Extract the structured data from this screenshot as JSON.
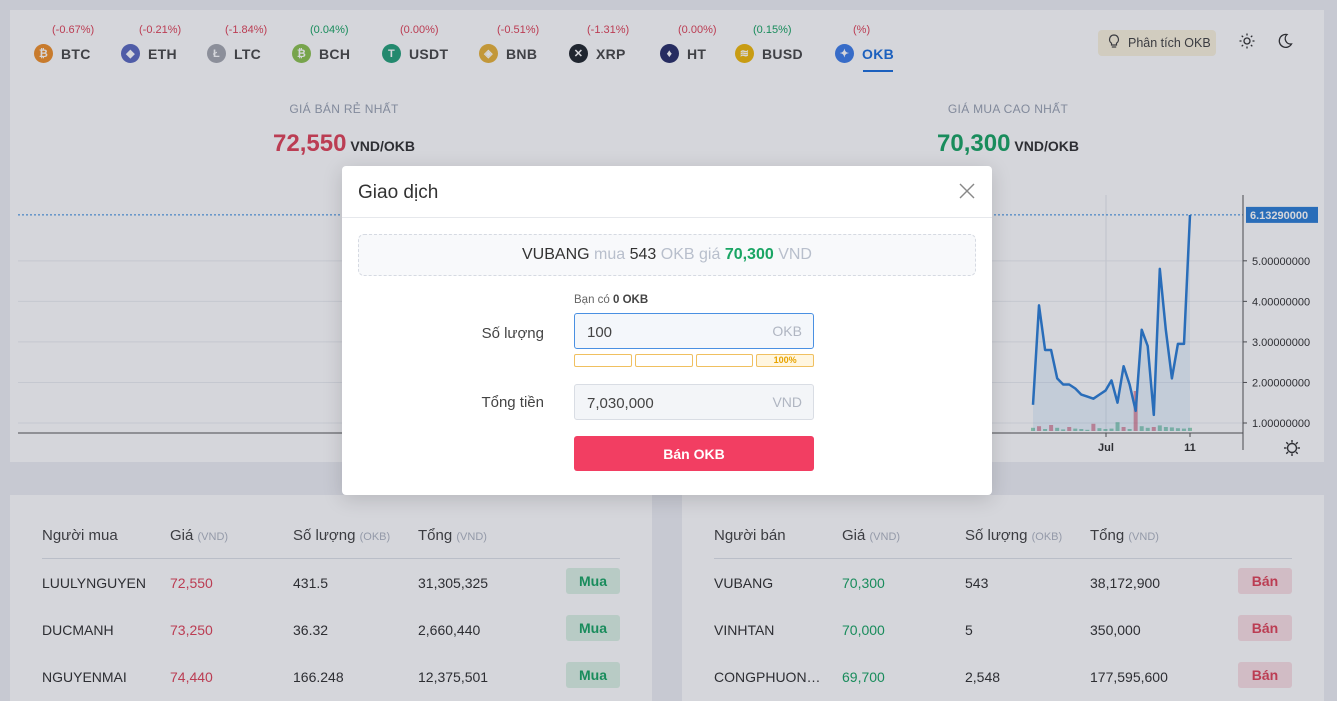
{
  "ticker": [
    {
      "symbol": "BTC",
      "change": "(-0.67%)",
      "trend": "neg",
      "color": "#f0902b",
      "glyph": "₿",
      "icon": "bitcoin-icon"
    },
    {
      "symbol": "ETH",
      "change": "(-0.21%)",
      "trend": "neg",
      "color": "#5c6bc0",
      "glyph": "◆",
      "icon": "ethereum-icon"
    },
    {
      "symbol": "LTC",
      "change": "(-1.84%)",
      "trend": "neg",
      "color": "#a6a9b0",
      "glyph": "Ł",
      "icon": "litecoin-icon"
    },
    {
      "symbol": "BCH",
      "change": "(0.04%)",
      "trend": "pos",
      "color": "#8dc351",
      "glyph": "₿",
      "icon": "bitcoin-cash-icon"
    },
    {
      "symbol": "USDT",
      "change": "(0.00%)",
      "trend": "neg",
      "color": "#26a17b",
      "glyph": "T",
      "icon": "tether-icon"
    },
    {
      "symbol": "BNB",
      "change": "(-0.51%)",
      "trend": "neg",
      "color": "#e8b33a",
      "glyph": "◈",
      "icon": "binance-coin-icon"
    },
    {
      "symbol": "XRP",
      "change": "(-1.31%)",
      "trend": "neg",
      "color": "#23292f",
      "glyph": "✕",
      "icon": "ripple-icon"
    },
    {
      "symbol": "HT",
      "change": "(0.00%)",
      "trend": "neg",
      "color": "#2a3069",
      "glyph": "♦",
      "icon": "huobi-token-icon"
    },
    {
      "symbol": "BUSD",
      "change": "(0.15%)",
      "trend": "pos",
      "color": "#f0b90b",
      "glyph": "≋",
      "icon": "busd-icon"
    },
    {
      "symbol": "OKB",
      "change": "(%)",
      "trend": "neg",
      "color": "#3f7ee8",
      "glyph": "✦",
      "icon": "okb-icon",
      "active": true
    }
  ],
  "header": {
    "analysis_label": "Phân tích OKB"
  },
  "prices": {
    "lowest_sell_label": "GIÁ BÁN RẺ NHẤT",
    "lowest_sell_value": "72,550",
    "highest_buy_label": "GIÁ MUA CAO NHẤT",
    "highest_buy_value": "70,300",
    "unit": "VND/OKB"
  },
  "chart_data": {
    "type": "line",
    "current_value_label": "6.13290000",
    "y_ticks": [
      "5.00000000",
      "4.00000000",
      "3.00000000",
      "2.00000000",
      "1.00000000"
    ],
    "x_ticks": [
      "Jul",
      "11"
    ],
    "ylim": [
      0.7,
      6.5
    ],
    "series": [
      {
        "values": [
          1.45,
          3.9,
          2.8,
          2.8,
          2.1,
          1.95,
          1.95,
          1.85,
          1.7,
          1.65,
          1.6,
          1.7,
          1.8,
          2.05,
          1.5,
          2.4,
          1.95,
          1.3,
          3.3,
          2.9,
          1.2,
          4.8,
          3.3,
          2.1,
          2.95,
          2.95,
          6.13
        ]
      }
    ],
    "volumes": [
      0.08,
      0.12,
      0.05,
      0.15,
      0.08,
      0.04,
      0.1,
      0.06,
      0.05,
      0.03,
      0.18,
      0.07,
      0.05,
      0.06,
      0.22,
      0.1,
      0.05,
      1.0,
      0.12,
      0.08,
      0.1,
      0.14,
      0.1,
      0.09,
      0.07,
      0.06,
      0.08
    ],
    "volume_colors": [
      "pos",
      "neg",
      "pos",
      "neg",
      "pos",
      "pos",
      "neg",
      "pos",
      "pos",
      "pos",
      "neg",
      "pos",
      "pos",
      "pos",
      "pos",
      "neg",
      "pos",
      "neg",
      "pos",
      "pos",
      "neg",
      "pos",
      "pos",
      "pos",
      "pos",
      "pos",
      "pos"
    ]
  },
  "buy_book": {
    "headers": {
      "user": "Người mua",
      "price": "Giá",
      "price_unit": "(VND)",
      "qty": "Số lượng",
      "qty_unit": "(OKB)",
      "total": "Tổng",
      "total_unit": "(VND)"
    },
    "rows": [
      {
        "user": "LUULYNGUYEN",
        "price": "72,550",
        "qty": "431.5",
        "total": "31,305,325",
        "action": "Mua"
      },
      {
        "user": "DUCMANH",
        "price": "73,250",
        "qty": "36.32",
        "total": "2,660,440",
        "action": "Mua"
      },
      {
        "user": "NGUYENMAI",
        "price": "74,440",
        "qty": "166.248",
        "total": "12,375,501",
        "action": "Mua"
      }
    ]
  },
  "sell_book": {
    "headers": {
      "user": "Người bán",
      "price": "Giá",
      "price_unit": "(VND)",
      "qty": "Số lượng",
      "qty_unit": "(OKB)",
      "total": "Tổng",
      "total_unit": "(VND)"
    },
    "rows": [
      {
        "user": "VUBANG",
        "price": "70,300",
        "qty": "543",
        "total": "38,172,900",
        "action": "Bán"
      },
      {
        "user": "VINHTAN",
        "price": "70,000",
        "qty": "5",
        "total": "350,000",
        "action": "Bán"
      },
      {
        "user": "CONGPHUON…",
        "price": "69,700",
        "qty": "2,548",
        "total": "177,595,600",
        "action": "Bán"
      }
    ]
  },
  "modal": {
    "title": "Giao dịch",
    "offer_user": "VUBANG",
    "offer_word_buy": "mua",
    "offer_qty": "543",
    "offer_coin_price": "OKB giá",
    "offer_price": "70,300",
    "offer_currency": "VND",
    "have_prefix": "Bạn có",
    "have_amount": "0 OKB",
    "qty_label": "Số lượng",
    "qty_value": "100",
    "qty_unit": "OKB",
    "percent_options": [
      "",
      "",
      "",
      "100%"
    ],
    "total_label": "Tổng tiền",
    "total_value": "7,030,000",
    "total_unit": "VND",
    "submit_label": "Bán OKB"
  },
  "colors": {
    "neg": "#e0455a",
    "pos": "#1aa564",
    "accent": "#1d6fdc",
    "sell_button": "#f23e62"
  }
}
